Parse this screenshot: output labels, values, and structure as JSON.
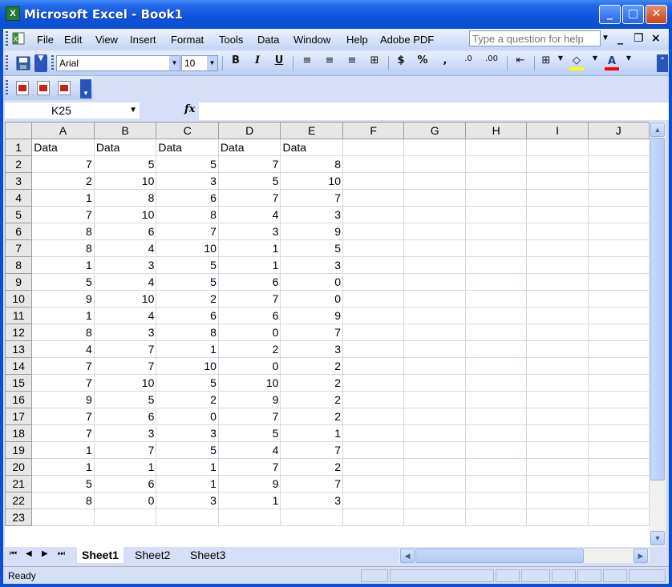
{
  "window": {
    "title": "Microsoft Excel - Book1",
    "app_icon": "excel-icon",
    "minimize_glyph": "_",
    "maximize_glyph": "□",
    "close_glyph": "✕"
  },
  "menubar": {
    "items": [
      "File",
      "Edit",
      "View",
      "Insert",
      "Format",
      "Tools",
      "Data",
      "Window",
      "Help",
      "Adobe PDF"
    ],
    "help_placeholder": "Type a question for help",
    "doc_minimize": "_",
    "doc_restore": "❐",
    "doc_close": "×"
  },
  "toolbar": {
    "font_name": "Arial",
    "font_size": "10",
    "bold": "B",
    "italic": "I",
    "underline": "U",
    "currency": "$",
    "percent": "%",
    "comma": ",",
    "increase_decimal": ".0",
    "decrease_decimal": ".00",
    "font_color_letter": "A",
    "fill_color": "#ffff00",
    "font_color": "#ff0000"
  },
  "formula_bar": {
    "name_box": "K25",
    "fx_label": "fx",
    "formula": ""
  },
  "sheet": {
    "columns": [
      "A",
      "B",
      "C",
      "D",
      "E",
      "F",
      "G",
      "H",
      "I",
      "J"
    ],
    "rows": [
      [
        "1",
        "Data",
        "Data",
        "Data",
        "Data",
        "Data"
      ],
      [
        "2",
        "7",
        "5",
        "5",
        "7",
        "8"
      ],
      [
        "3",
        "2",
        "10",
        "3",
        "5",
        "10"
      ],
      [
        "4",
        "1",
        "8",
        "6",
        "7",
        "7"
      ],
      [
        "5",
        "7",
        "10",
        "8",
        "4",
        "3"
      ],
      [
        "6",
        "8",
        "6",
        "7",
        "3",
        "9"
      ],
      [
        "7",
        "8",
        "4",
        "10",
        "1",
        "5"
      ],
      [
        "8",
        "1",
        "3",
        "5",
        "1",
        "3"
      ],
      [
        "9",
        "5",
        "4",
        "5",
        "6",
        "0"
      ],
      [
        "10",
        "9",
        "10",
        "2",
        "7",
        "0"
      ],
      [
        "11",
        "1",
        "4",
        "6",
        "6",
        "9"
      ],
      [
        "12",
        "8",
        "3",
        "8",
        "0",
        "7"
      ],
      [
        "13",
        "4",
        "7",
        "1",
        "2",
        "3"
      ],
      [
        "14",
        "7",
        "7",
        "10",
        "0",
        "2"
      ],
      [
        "15",
        "7",
        "10",
        "5",
        "10",
        "2"
      ],
      [
        "16",
        "9",
        "5",
        "2",
        "9",
        "2"
      ],
      [
        "17",
        "7",
        "6",
        "0",
        "7",
        "2"
      ],
      [
        "18",
        "7",
        "3",
        "3",
        "5",
        "1"
      ],
      [
        "19",
        "1",
        "7",
        "5",
        "4",
        "7"
      ],
      [
        "20",
        "1",
        "1",
        "1",
        "7",
        "2"
      ],
      [
        "21",
        "5",
        "6",
        "1",
        "9",
        "7"
      ],
      [
        "22",
        "8",
        "0",
        "3",
        "1",
        "3"
      ],
      [
        "23",
        "",
        "",
        "",
        "",
        ""
      ]
    ]
  },
  "tabs": {
    "sheets": [
      "Sheet1",
      "Sheet2",
      "Sheet3"
    ],
    "active": "Sheet1"
  },
  "status": {
    "text": "Ready"
  }
}
